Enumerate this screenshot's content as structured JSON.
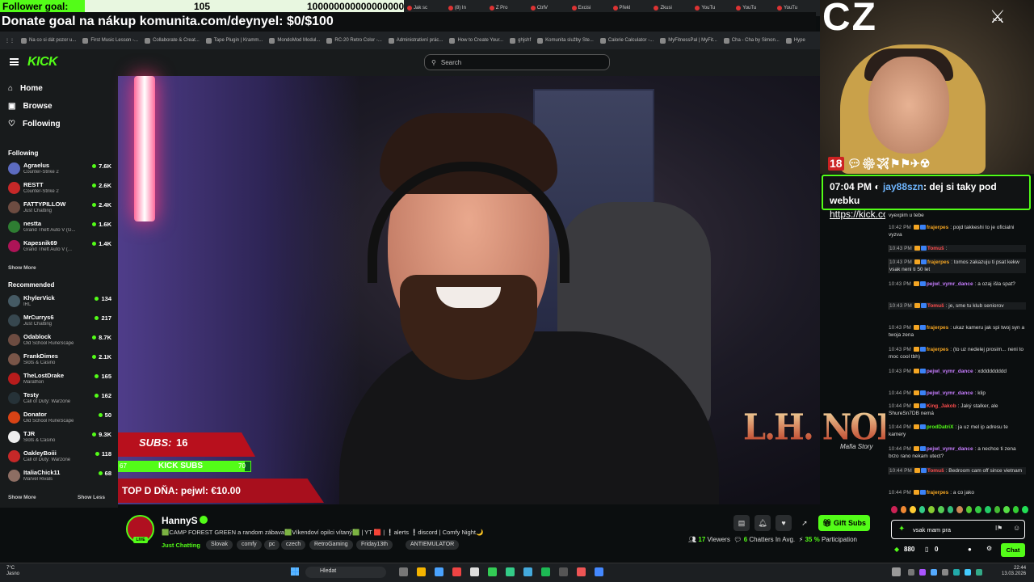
{
  "overlay": {
    "goal_label": "Follower goal:",
    "goal_current": "105",
    "goal_target": "100000000000000000",
    "goal_progress": 0.21,
    "donate_text": "Donate goal na nákup komunita.com/deynyel: $0/$100",
    "webcam_text": "CZ",
    "badges": "18"
  },
  "browser": {
    "tabs": [
      "Jak sc",
      "(8) In",
      "Z Pro",
      "CtrlV",
      "Excisi",
      "Překl",
      "Zkusi",
      "YouTu",
      "YouTu",
      "YouTu"
    ],
    "bookmarks": [
      "Na co si dát pozor u...",
      "First Music Lesson -...",
      "Collaborate & Creat...",
      "Tape Plugin | Kramm...",
      "MondoMod Modul...",
      "RC-20 Retro Color -...",
      "Administrativní prác...",
      "How to Create Your...",
      "ghjshf",
      "Komunita služby Ste...",
      "Calorie Calculator -...",
      "MyFitnessPal | MyFit...",
      "Cha - Cha by Simon...",
      "Hype"
    ]
  },
  "header": {
    "logo": "KICK",
    "search_placeholder": "Search"
  },
  "sidebar": {
    "nav": [
      {
        "label": "Home",
        "icon": "home-icon"
      },
      {
        "label": "Browse",
        "icon": "browse-icon"
      },
      {
        "label": "Following",
        "icon": "heart-icon"
      }
    ],
    "following_title": "Following",
    "following": [
      {
        "name": "Agraelus",
        "game": "Counter-Strike 2",
        "viewers": "7.6K",
        "color": "#5c6bc0"
      },
      {
        "name": "RESTT",
        "game": "Counter-Strike 2",
        "viewers": "2.6K",
        "color": "#c62828"
      },
      {
        "name": "FATTYPILLOW",
        "game": "Just Chatting",
        "viewers": "2.4K",
        "color": "#6d4c41"
      },
      {
        "name": "nestta",
        "game": "Grand Theft Auto V (G...",
        "viewers": "1.6K",
        "color": "#2e7d32"
      },
      {
        "name": "Kapesnik69",
        "game": "Grand Theft Auto V (...",
        "viewers": "1.4K",
        "color": "#ad1457"
      }
    ],
    "show_more": "Show More",
    "recommended_title": "Recommended",
    "recommended": [
      {
        "name": "KhylerVick",
        "game": "IRL",
        "viewers": "134",
        "color": "#455a64"
      },
      {
        "name": "MrCurrys6",
        "game": "Just Chatting",
        "viewers": "217",
        "color": "#37474f"
      },
      {
        "name": "Odablock",
        "game": "Old School RuneScape",
        "viewers": "8.7K",
        "color": "#6d4c41"
      },
      {
        "name": "FrankDimes",
        "game": "Slots & Casino",
        "viewers": "2.1K",
        "color": "#795548"
      },
      {
        "name": "TheLostDrake",
        "game": "Marathon",
        "viewers": "165",
        "color": "#b71c1c"
      },
      {
        "name": "Testy",
        "game": "Call of Duty: Warzone",
        "viewers": "162",
        "color": "#263238"
      },
      {
        "name": "Donator",
        "game": "Old School RuneScape",
        "viewers": "50",
        "color": "#d84315"
      },
      {
        "name": "TJR",
        "game": "Slots & Casino",
        "viewers": "9.3K",
        "color": "#eeeeee"
      },
      {
        "name": "OakleyBoiii",
        "game": "Call of Duty: Warzone",
        "viewers": "118",
        "color": "#c62828"
      },
      {
        "name": "ItaliaChick11",
        "game": "Marvel Rivals",
        "viewers": "68",
        "color": "#8d6e63"
      }
    ],
    "show_less": "Show Less"
  },
  "stream_overlay": {
    "subs_label": "SUBS:",
    "subs_value": "16",
    "kick_subs_label": "KICK SUBS",
    "kick_subs_min": "67",
    "kick_subs_max": "70",
    "kick_subs_progress": 0.96,
    "top_label": "TOP D DŇA: pejwl: €10.00",
    "noire_title": "L.H. NOIRE",
    "noire_sub": "Mafia Story"
  },
  "channel": {
    "name": "HannyS",
    "title": "🟩CAMP FOREST GREEN a random zábava🟩Víkendoví opilci vítaný🟩 | YT 🟥 | ❕alerts ❕discord | Comfy Night🌙",
    "category": "Just Chatting",
    "tags": [
      "Slovak",
      "comfy",
      "pc",
      "czech",
      "RetroGaming",
      "Friday13th",
      "ANTIEMULATOR"
    ],
    "viewers": "17",
    "viewers_label": "Viewers",
    "chatters": "6",
    "chatters_label": "Chatters In Avg.",
    "participation": "35 %",
    "participation_label": "Participation",
    "gift_label": "Gift Subs",
    "live_label": "LIVE"
  },
  "popup": {
    "time": "07:04 PM",
    "user": "jay88szn",
    "message": "dej si taky pod webku",
    "link": "https://kick.com/frajerpes"
  },
  "chat": {
    "messages": [
      {
        "time": "",
        "user": "",
        "color": "#ddd",
        "text": "vyexpim u tebe",
        "hl": false
      },
      {
        "time": "10:42 PM",
        "user": "frajerpes",
        "color": "#f5a623",
        "text": "pojd takkeshi to je oficialni vyzva",
        "hl": false
      },
      {
        "time": "10:43 PM",
        "user": "Tomuš",
        "color": "#ff4d4d",
        "text": "",
        "hl": true
      },
      {
        "time": "10:43 PM",
        "user": "frajerpes",
        "color": "#f5a623",
        "text": "tomos zakazuju ti psat kekw vsak neni ti 50 let",
        "hl": true
      },
      {
        "time": "10:43 PM",
        "user": "pejwl_vymr_dance",
        "color": "#c77dff",
        "text": "a ozaj išla spat?",
        "hl": false
      },
      {
        "time": "10:43 PM",
        "user": "Tomuš",
        "color": "#ff4d4d",
        "text": "je, sme tu klub seniorov",
        "hl": true
      },
      {
        "time": "10:43 PM",
        "user": "frajerpes",
        "color": "#f5a623",
        "text": "ukaz kameru jak spi twoj syn a twoja zena",
        "hl": false
      },
      {
        "time": "10:43 PM",
        "user": "frajerpes",
        "color": "#f5a623",
        "text": "(to uz nedelej prosim... neni to moc cool tbh)",
        "hl": false
      },
      {
        "time": "10:43 PM",
        "user": "pejwl_vymr_dance",
        "color": "#c77dff",
        "text": "xddddddddd",
        "hl": false
      },
      {
        "time": "10:44 PM",
        "user": "pejwl_vymr_dance",
        "color": "#c77dff",
        "text": "klip",
        "hl": false
      },
      {
        "time": "10:44 PM",
        "user": "King_Jakob",
        "color": "#ff4d4d",
        "text": "Jaký stalker, ale ShureSn7DB nemá",
        "hl": false
      },
      {
        "time": "10:44 PM",
        "user": "prodDatriX",
        "color": "#53fc18",
        "text": "ja uz mel ip adresu te kamery",
        "hl": false
      },
      {
        "time": "10:44 PM",
        "user": "pejwl_vymr_dance",
        "color": "#c77dff",
        "text": "a nechce ti zena brzo rano nekam utect?",
        "hl": false
      },
      {
        "time": "10:44 PM",
        "user": "Tomuš",
        "color": "#ff4d4d",
        "text": "Bedroom cam off since vietnam",
        "hl": true
      },
      {
        "time": "10:44 PM",
        "user": "frajerpes",
        "color": "#f5a623",
        "text": "a co jako",
        "hl": false
      }
    ],
    "input_value": "vsak mam pra",
    "points": "880",
    "count": "0",
    "send_label": "Chat"
  },
  "taskbar": {
    "temp": "7°C",
    "weather": "Jasno",
    "search_label": "Hledat",
    "time": "22:44",
    "date": "13.03.2026"
  }
}
